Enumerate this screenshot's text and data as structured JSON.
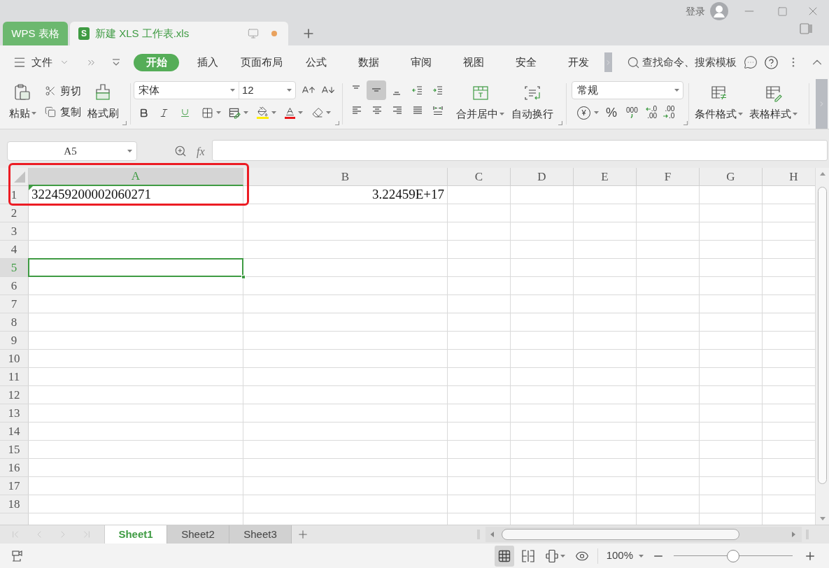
{
  "title_bar": {
    "tabs": [
      {
        "kind": "app",
        "label": "WPS 表格",
        "selected": false
      },
      {
        "kind": "document",
        "label": "新建 XLS 工作表.xls",
        "icon_text": "S",
        "selected": true,
        "unsaved": true
      }
    ],
    "login": "登录"
  },
  "menu_bar": {
    "file": "文件",
    "tabs": [
      {
        "label": "开始",
        "selected": true
      },
      {
        "label": "插入",
        "selected": false
      },
      {
        "label": "页面布局",
        "selected": false
      },
      {
        "label": "公式",
        "selected": false
      },
      {
        "label": "数据",
        "selected": false
      },
      {
        "label": "审阅",
        "selected": false
      },
      {
        "label": "视图",
        "selected": false
      },
      {
        "label": "安全",
        "selected": false
      },
      {
        "label": "开发",
        "selected": false
      }
    ],
    "search": {
      "placeholder": "查找命令、搜索模板"
    }
  },
  "ribbon": {
    "clipboard": {
      "paste": "粘贴",
      "cut": "剪切",
      "copy": "复制",
      "format_painter": "格式刷"
    },
    "font": {
      "name": "宋体",
      "size": "12"
    },
    "vertical_align": [
      {
        "kind": "top",
        "selected": false
      },
      {
        "kind": "middle",
        "selected": true
      },
      {
        "kind": "bottom",
        "selected": false
      }
    ],
    "merge": "合并居中",
    "wrap": "自动换行",
    "number": {
      "format": "常规",
      "currency": "¥",
      "percent": "%",
      "thousands": "000",
      "increase_decimal": {
        "top": ".0",
        "bottom": ".00"
      },
      "decrease_decimal": {
        "top": ".00",
        "bottom": ".0"
      }
    },
    "conditional_format": "条件格式",
    "table_style": "表格样式"
  },
  "formula_bar": {
    "name_box": "A5",
    "function_label": "fx"
  },
  "sheet": {
    "highlight_frame": true,
    "columns": [
      {
        "label": "A",
        "selected": true
      },
      {
        "label": "B",
        "selected": false
      },
      {
        "label": "C",
        "selected": false
      },
      {
        "label": "D",
        "selected": false
      },
      {
        "label": "E",
        "selected": false
      },
      {
        "label": "F",
        "selected": false
      },
      {
        "label": "G",
        "selected": false
      },
      {
        "label": "H",
        "selected": false
      }
    ],
    "rows": [
      {
        "label": "1",
        "selected": false,
        "cells": [
          {
            "value": "322459200002060271",
            "kind": "text",
            "error_flag": true
          },
          {
            "value": "3.22459E+17",
            "kind": "number",
            "error_flag": false
          }
        ]
      },
      {
        "label": "2",
        "selected": false
      },
      {
        "label": "3",
        "selected": false
      },
      {
        "label": "4",
        "selected": false
      },
      {
        "label": "5",
        "selected": true
      },
      {
        "label": "6",
        "selected": false
      },
      {
        "label": "7",
        "selected": false
      },
      {
        "label": "8",
        "selected": false
      },
      {
        "label": "9",
        "selected": false
      },
      {
        "label": "10",
        "selected": false
      },
      {
        "label": "11",
        "selected": false
      },
      {
        "label": "12",
        "selected": false
      },
      {
        "label": "13",
        "selected": false
      },
      {
        "label": "14",
        "selected": false
      },
      {
        "label": "15",
        "selected": false
      },
      {
        "label": "16",
        "selected": false
      },
      {
        "label": "17",
        "selected": false
      },
      {
        "label": "18",
        "selected": false
      }
    ]
  },
  "sheet_tabs": [
    {
      "label": "Sheet1",
      "selected": true
    },
    {
      "label": "Sheet2",
      "selected": false
    },
    {
      "label": "Sheet3",
      "selected": false
    }
  ],
  "status_bar": {
    "views": [
      {
        "kind": "normal",
        "selected": true
      },
      {
        "kind": "page_break",
        "selected": false
      },
      {
        "kind": "page_layout",
        "selected": false
      },
      {
        "kind": "reading",
        "selected": false
      }
    ],
    "zoom": "100%",
    "zoom_slider": {
      "level": 0.5
    }
  }
}
